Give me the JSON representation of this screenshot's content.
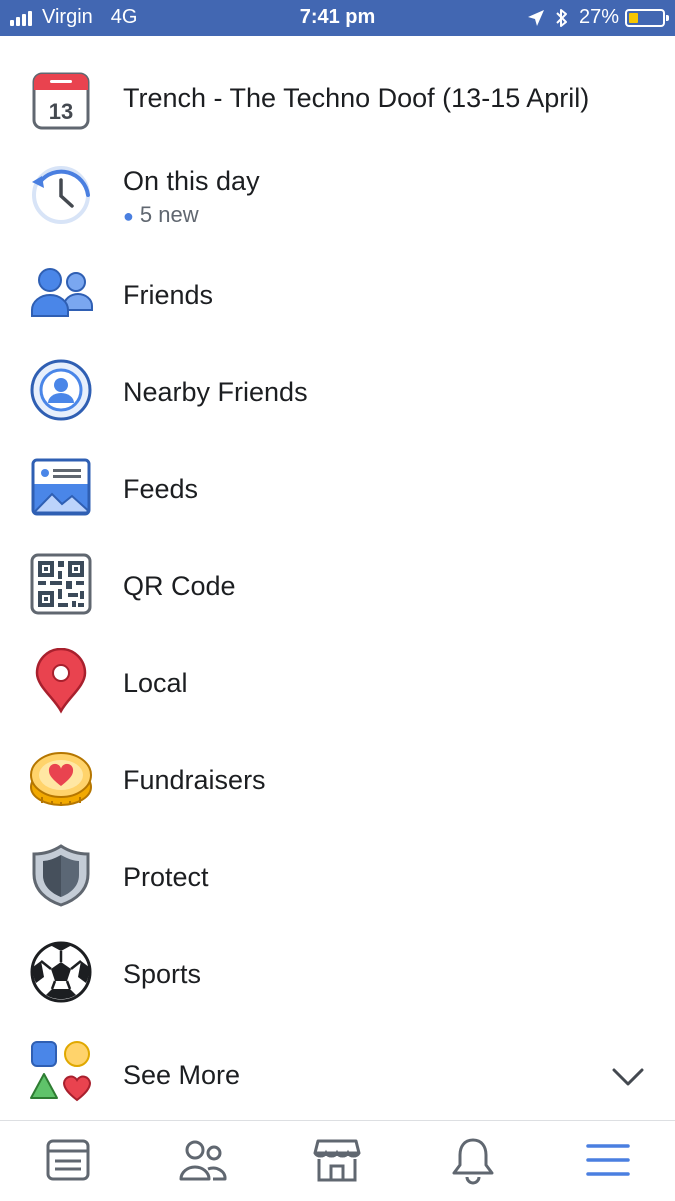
{
  "status_bar": {
    "carrier": "Virgin",
    "network": "4G",
    "time": "7:41 pm",
    "battery": "27%",
    "battery_level": 0.27,
    "icons": [
      "signal-icon",
      "location-icon",
      "bluetooth-icon",
      "battery-icon"
    ]
  },
  "menu": {
    "items": [
      {
        "label": "Trench - The Techno Doof (13-15 April)",
        "icon": "calendar-icon",
        "icon_text": "13"
      },
      {
        "label": "On this day",
        "sub": "5 new",
        "icon": "clock-history-icon"
      },
      {
        "label": "Friends",
        "icon": "friends-icon"
      },
      {
        "label": "Nearby Friends",
        "icon": "nearby-friends-icon"
      },
      {
        "label": "Feeds",
        "icon": "feeds-icon"
      },
      {
        "label": "QR Code",
        "icon": "qr-code-icon"
      },
      {
        "label": "Local",
        "icon": "map-pin-icon"
      },
      {
        "label": "Fundraisers",
        "icon": "fundraiser-heart-icon"
      },
      {
        "label": "Protect",
        "icon": "shield-icon"
      },
      {
        "label": "Sports",
        "icon": "soccer-ball-icon"
      },
      {
        "label": "See More",
        "icon": "shapes-icon",
        "trailing_icon": "chevron-down-icon"
      }
    ]
  },
  "tab_bar": {
    "tabs": [
      {
        "name": "news-feed",
        "icon": "news-feed-icon",
        "active": false
      },
      {
        "name": "friends",
        "icon": "friends-tab-icon",
        "active": false
      },
      {
        "name": "marketplace",
        "icon": "marketplace-icon",
        "active": false
      },
      {
        "name": "notifications",
        "icon": "bell-icon",
        "active": false
      },
      {
        "name": "menu",
        "icon": "hamburger-menu-icon",
        "active": true
      }
    ]
  },
  "colors": {
    "status_bar_bg": "#4267b2",
    "accent_blue": "#4a7fe0",
    "text_primary": "#1c1e21",
    "text_secondary": "#606770",
    "battery_fill": "#f7c600"
  }
}
